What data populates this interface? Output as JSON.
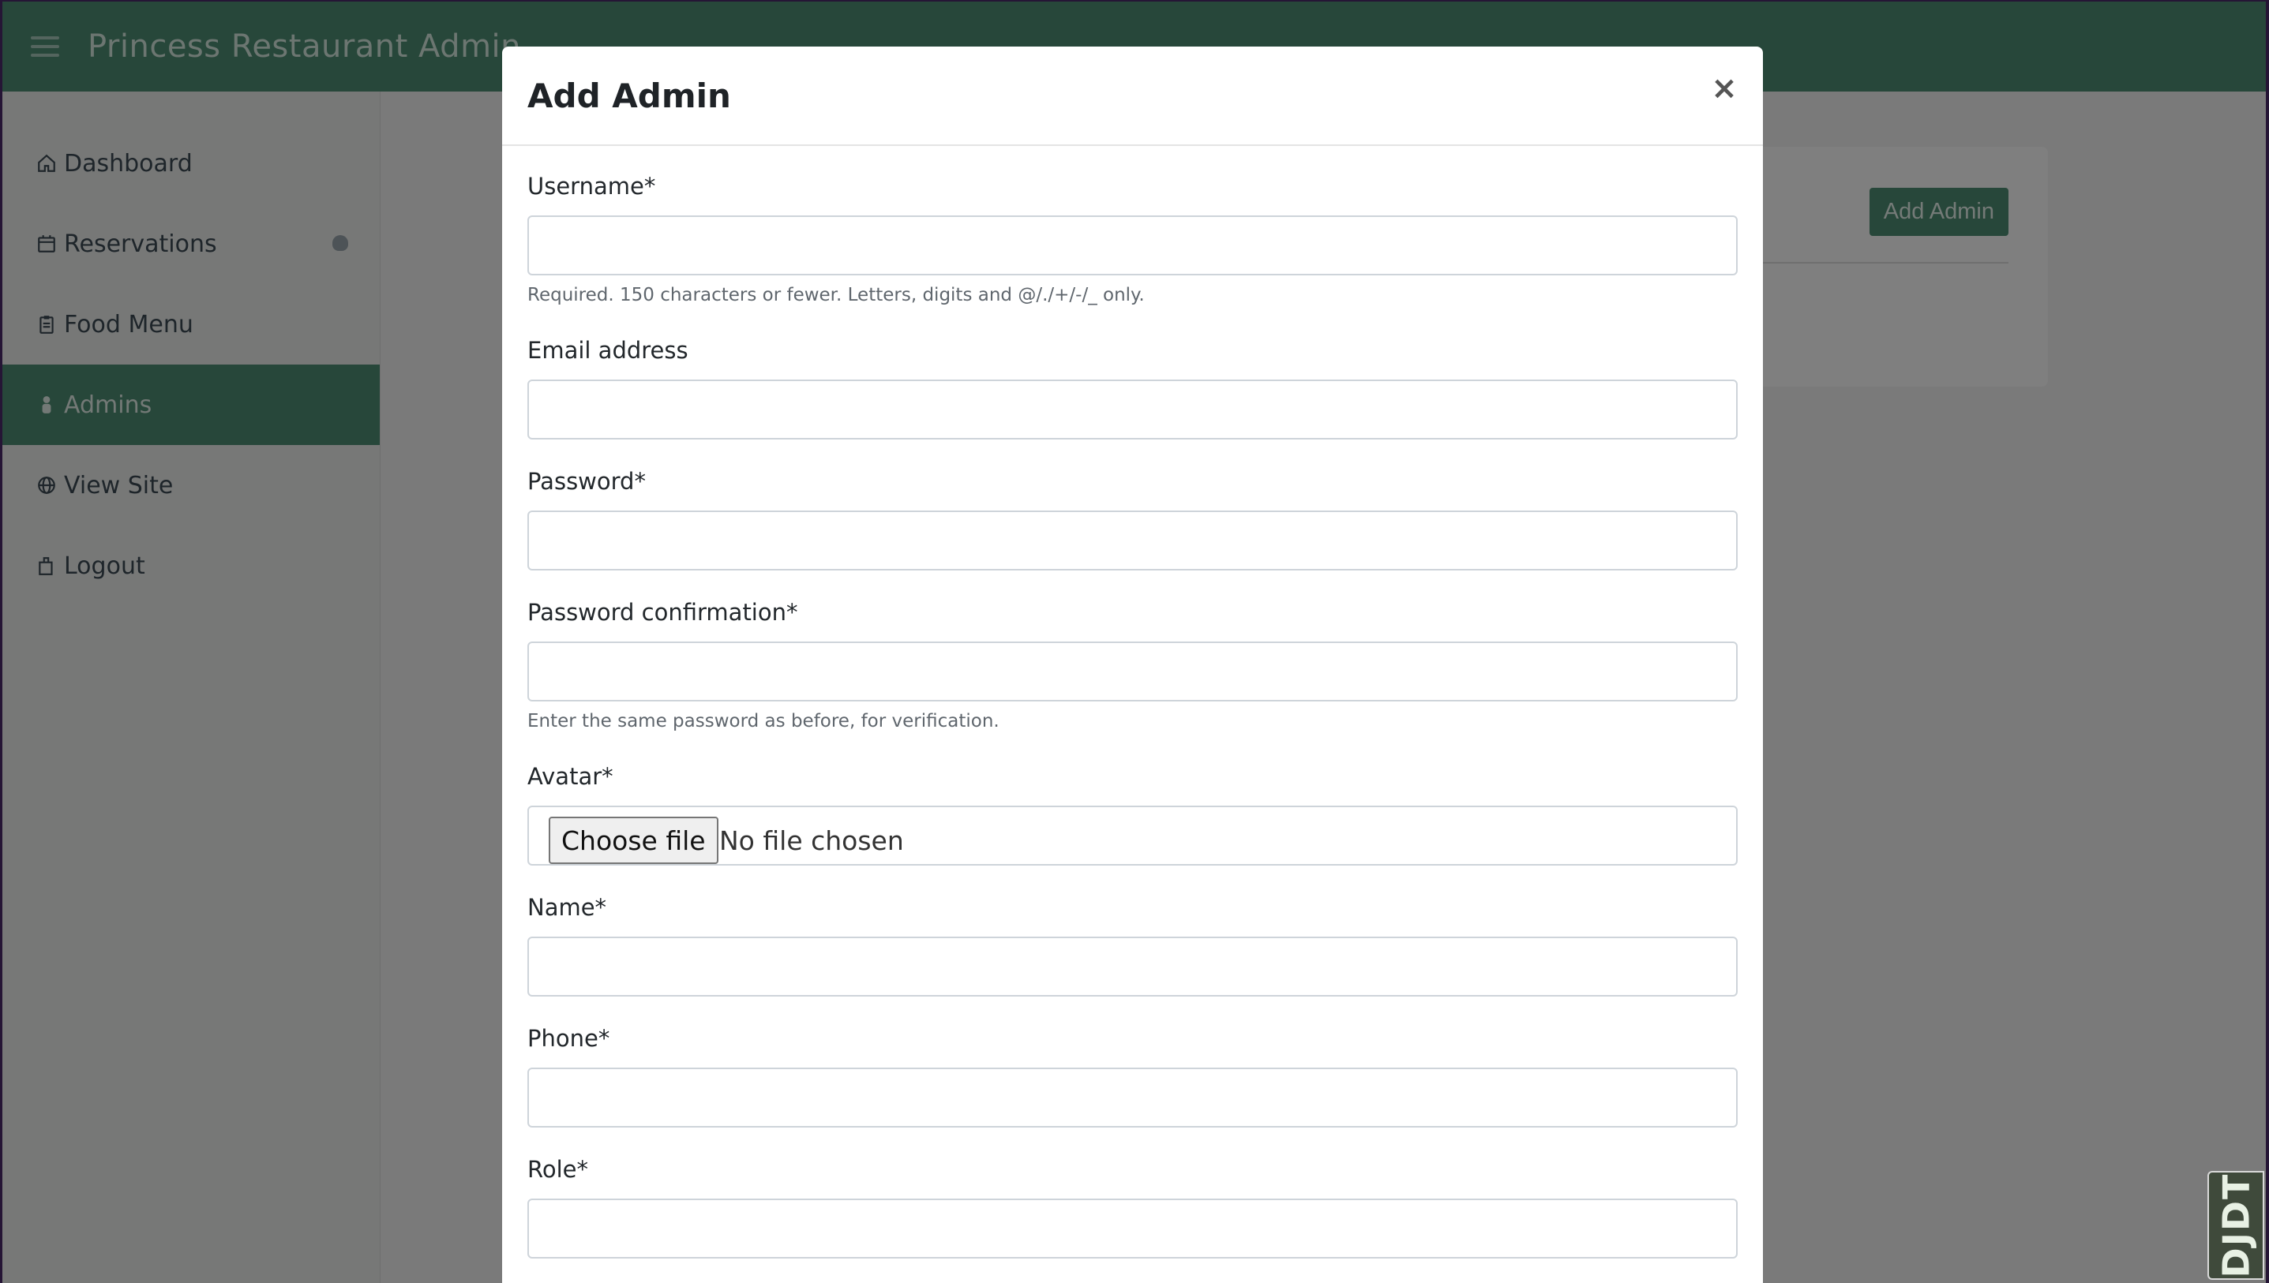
{
  "app": {
    "brand": "Princess Restaurant Admin"
  },
  "sidebar": {
    "items": [
      {
        "label": "Dashboard",
        "icon": "home-icon"
      },
      {
        "label": "Reservations",
        "icon": "calendar-icon"
      },
      {
        "label": "Food Menu",
        "icon": "clipboard-icon"
      },
      {
        "label": "Admins",
        "icon": "user-icon",
        "active": true
      },
      {
        "label": "View Site",
        "icon": "globe-icon"
      },
      {
        "label": "Logout",
        "icon": "logout-icon"
      }
    ]
  },
  "content": {
    "add_admin_label": "Add Admin"
  },
  "modal": {
    "title": "Add Admin",
    "close_label": "×",
    "fields": {
      "username": {
        "label": "Username*",
        "help": "Required. 150 characters or fewer. Letters, digits and @/./+/-/_ only.",
        "value": ""
      },
      "email": {
        "label": "Email address",
        "value": ""
      },
      "password": {
        "label": "Password*",
        "value": ""
      },
      "password_confirm": {
        "label": "Password confirmation*",
        "help": "Enter the same password as before, for verification.",
        "value": ""
      },
      "avatar": {
        "label": "Avatar*",
        "button_label": "Choose file",
        "status": "No file chosen"
      },
      "name": {
        "label": "Name*",
        "value": ""
      },
      "phone": {
        "label": "Phone*",
        "value": ""
      },
      "role": {
        "label": "Role*",
        "value": ""
      }
    }
  },
  "toolbar": {
    "djdt_label": "DJDT"
  },
  "colors": {
    "primary": "#4f8f74",
    "backdrop": "rgba(0,0,0,0.5)"
  }
}
